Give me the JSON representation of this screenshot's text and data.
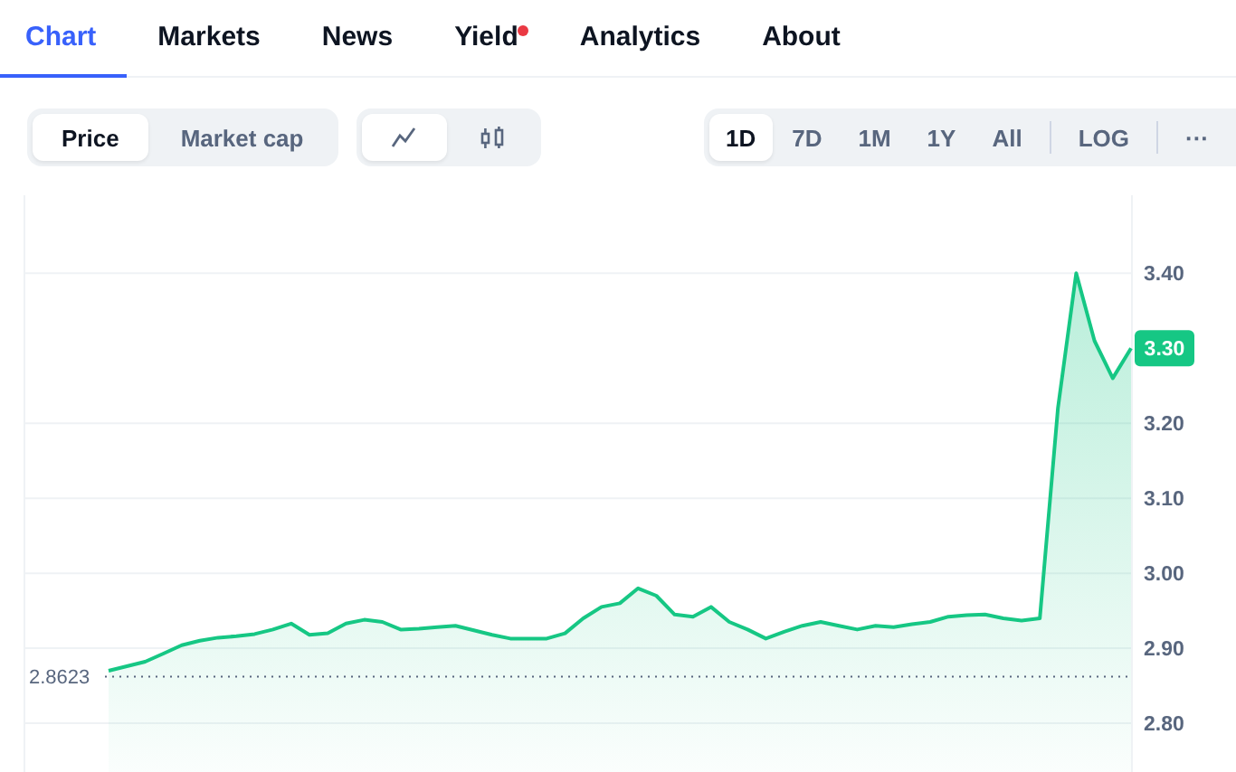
{
  "tabs": [
    {
      "label": "Chart",
      "selected": true,
      "notification": false
    },
    {
      "label": "Markets",
      "selected": false,
      "notification": false
    },
    {
      "label": "News",
      "selected": false,
      "notification": false
    },
    {
      "label": "Yield",
      "selected": false,
      "notification": true
    },
    {
      "label": "Analytics",
      "selected": false,
      "notification": false
    },
    {
      "label": "About",
      "selected": false,
      "notification": false
    }
  ],
  "metric_toggle": [
    {
      "label": "Price",
      "selected": true
    },
    {
      "label": "Market cap",
      "selected": false
    }
  ],
  "chart_type_toggle": [
    {
      "kind": "line",
      "selected": true
    },
    {
      "kind": "candles",
      "selected": false
    }
  ],
  "ranges": [
    {
      "label": "1D",
      "selected": true
    },
    {
      "label": "7D",
      "selected": false
    },
    {
      "label": "1M",
      "selected": false
    },
    {
      "label": "1Y",
      "selected": false
    },
    {
      "label": "All",
      "selected": false
    }
  ],
  "scale_button": "LOG",
  "more_button": "···",
  "price_chart": {
    "current_price": "3.30",
    "chart_data": {
      "type": "area",
      "grid": true,
      "ylim": [
        2.735,
        3.504
      ],
      "yticks": [
        {
          "value": 2.8,
          "label": "2.80"
        },
        {
          "value": 2.9,
          "label": "2.90"
        },
        {
          "value": 3.0,
          "label": "3.00"
        },
        {
          "value": 3.1,
          "label": "3.10"
        },
        {
          "value": 3.2,
          "label": "3.20"
        },
        {
          "value": 3.4,
          "label": "3.40"
        }
      ],
      "ref_lines": [
        {
          "axis": "y",
          "value": 2.8623,
          "label": "2.8623"
        }
      ],
      "series": [
        {
          "color": "#16c784",
          "values": [
            2.87,
            2.876,
            2.882,
            2.893,
            2.904,
            2.91,
            2.914,
            2.916,
            2.919,
            2.925,
            2.933,
            2.918,
            2.92,
            2.933,
            2.938,
            2.935,
            2.925,
            2.926,
            2.928,
            2.93,
            2.924,
            2.918,
            2.913,
            2.913,
            2.913,
            2.92,
            2.94,
            2.955,
            2.96,
            2.98,
            2.97,
            2.945,
            2.942,
            2.955,
            2.935,
            2.925,
            2.913,
            2.922,
            2.93,
            2.935,
            2.93,
            2.925,
            2.93,
            2.928,
            2.932,
            2.935,
            2.942,
            2.944,
            2.945,
            2.94,
            2.937,
            2.94,
            3.22,
            3.4,
            3.31,
            3.26,
            3.3
          ]
        }
      ]
    }
  }
}
